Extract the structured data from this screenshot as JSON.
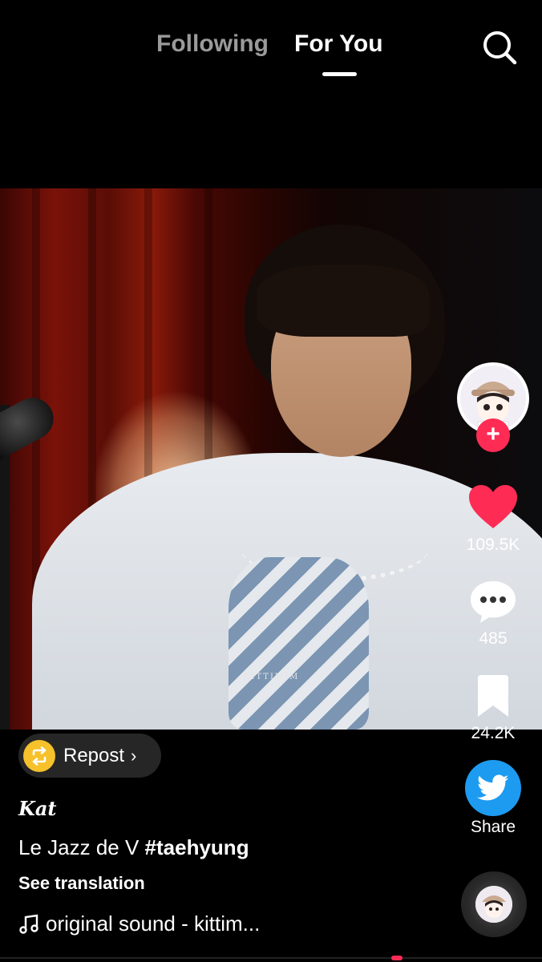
{
  "topnav": {
    "tabs": [
      {
        "label": "Following",
        "active": false
      },
      {
        "label": "For You",
        "active": true
      }
    ],
    "search_icon": "search-icon"
  },
  "video": {
    "watermark": "KITTIMIM"
  },
  "actions": {
    "likes": "109.5K",
    "comments": "485",
    "saves": "24.2K",
    "share_label": "Share",
    "like_color": "#fe2c55",
    "share_color": "#1d9bf0"
  },
  "post": {
    "repost_label": "Repost",
    "repost_color": "#f6c12b",
    "username": "Kat",
    "caption_text": "Le Jazz de V ",
    "hashtag": "#taehyung",
    "see_translation": "See translation",
    "sound": "original sound - kittim..."
  }
}
